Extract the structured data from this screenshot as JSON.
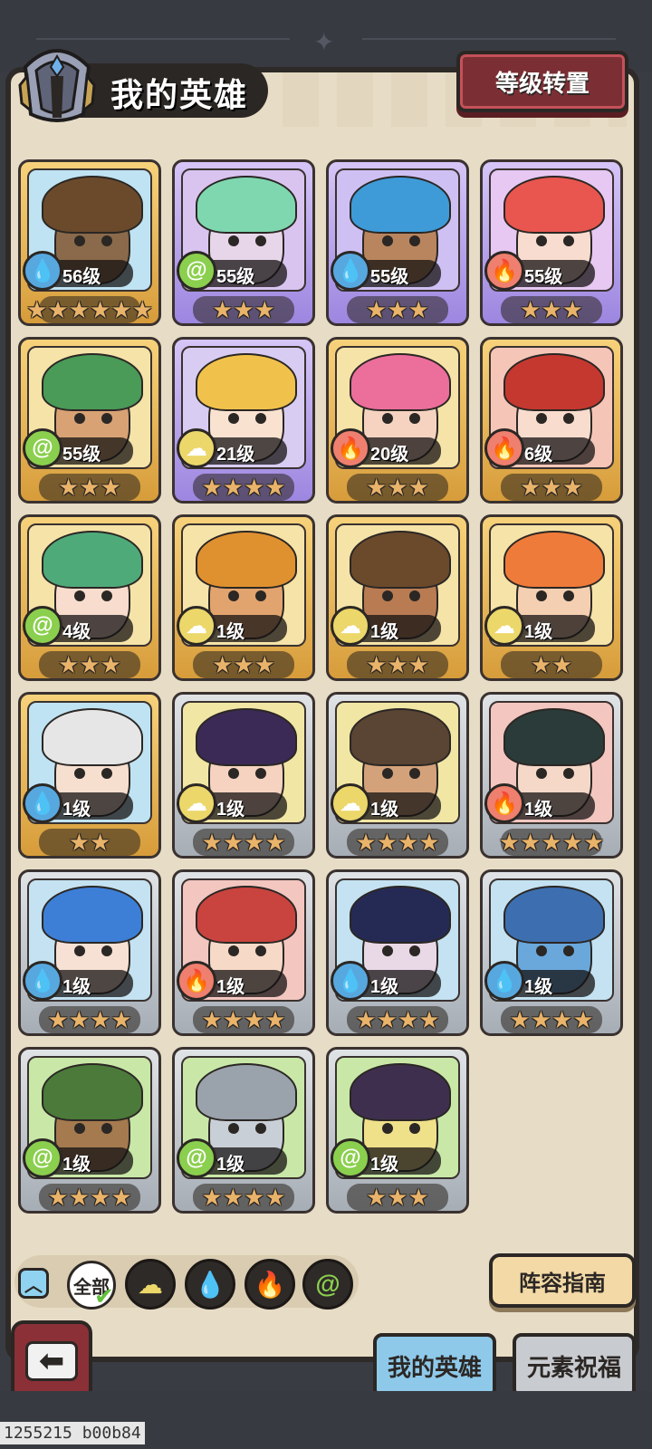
{
  "header": {
    "title": "我的英雄",
    "level_transfer_button": "等级转置"
  },
  "heroes": [
    {
      "level": "56级",
      "stars": 6,
      "element": "water",
      "frame": "gold",
      "bg": "#bfe3f2",
      "skin": "#8a6a4a",
      "hair": "#6b4a2c"
    },
    {
      "level": "55级",
      "stars": 3,
      "element": "wind",
      "frame": "purple",
      "bg": "#d9c4f0",
      "skin": "#e7d6ea",
      "hair": "#7fd7b0"
    },
    {
      "level": "55级",
      "stars": 3,
      "element": "water",
      "frame": "purple",
      "bg": "#cfc0f3",
      "skin": "#b9855e",
      "hair": "#3e9bd8"
    },
    {
      "level": "55级",
      "stars": 3,
      "element": "fire",
      "frame": "purple",
      "bg": "#e6c8f3",
      "skin": "#f8dcd0",
      "hair": "#e8564f"
    },
    {
      "level": "55级",
      "stars": 3,
      "element": "wind",
      "frame": "gold",
      "bg": "#f6e3a8",
      "skin": "#d8a275",
      "hair": "#4a9a58"
    },
    {
      "level": "21级",
      "stars": 4,
      "element": "earth",
      "frame": "purple",
      "bg": "#d8ccf2",
      "skin": "#fae2d1",
      "hair": "#f1c24b"
    },
    {
      "level": "20级",
      "stars": 3,
      "element": "fire",
      "frame": "gold",
      "bg": "#f6e3a8",
      "skin": "#f5d3c0",
      "hair": "#ec6e9b"
    },
    {
      "level": "6级",
      "stars": 3,
      "element": "fire",
      "frame": "gold",
      "bg": "#f5c6b8",
      "skin": "#f8dccd",
      "hair": "#c5382f"
    },
    {
      "level": "4级",
      "stars": 3,
      "element": "wind",
      "frame": "gold",
      "bg": "#f6e3a8",
      "skin": "#f8dccd",
      "hair": "#4faa7a"
    },
    {
      "level": "1级",
      "stars": 3,
      "element": "earth",
      "frame": "gold",
      "bg": "#f6e3a8",
      "skin": "#e2a46e",
      "hair": "#e0912f"
    },
    {
      "level": "1级",
      "stars": 3,
      "element": "earth",
      "frame": "gold",
      "bg": "#f6e3a8",
      "skin": "#b97b52",
      "hair": "#6b4a2c"
    },
    {
      "level": "1级",
      "stars": 2,
      "element": "earth",
      "frame": "gold",
      "bg": "#f6e3a8",
      "skin": "#f5cfb2",
      "hair": "#ef7b3a"
    },
    {
      "level": "1级",
      "stars": 2,
      "element": "water",
      "frame": "gold",
      "bg": "#bfe3f2",
      "skin": "#f7dfd0",
      "hair": "#e6e6e6"
    },
    {
      "level": "1级",
      "stars": 4,
      "element": "earth",
      "frame": "silver",
      "bg": "#f1e6a4",
      "skin": "#f5d3c0",
      "hair": "#3b2a55"
    },
    {
      "level": "1级",
      "stars": 4,
      "element": "earth",
      "frame": "silver",
      "bg": "#f1e6a4",
      "skin": "#d4a27a",
      "hair": "#5a4433"
    },
    {
      "level": "1级",
      "stars": 5,
      "element": "fire",
      "frame": "silver",
      "bg": "#f3c6c0",
      "skin": "#f5d8c8",
      "hair": "#2b3b3a"
    },
    {
      "level": "1级",
      "stars": 4,
      "element": "water",
      "frame": "silver",
      "bg": "#c4e2f1",
      "skin": "#f7e1d4",
      "hair": "#3d7fd6"
    },
    {
      "level": "1级",
      "stars": 4,
      "element": "fire",
      "frame": "silver",
      "bg": "#f3c6c0",
      "skin": "#f7d9c8",
      "hair": "#c9443e"
    },
    {
      "level": "1级",
      "stars": 4,
      "element": "water",
      "frame": "silver",
      "bg": "#c4e2f1",
      "skin": "#e9d8e6",
      "hair": "#252a55"
    },
    {
      "level": "1级",
      "stars": 4,
      "element": "water",
      "frame": "silver",
      "bg": "#c4e2f1",
      "skin": "#6aa8dc",
      "hair": "#3d6fb0"
    },
    {
      "level": "1级",
      "stars": 4,
      "element": "wind",
      "frame": "silver",
      "bg": "#c9e8a8",
      "skin": "#a57a4f",
      "hair": "#4b7a3a"
    },
    {
      "level": "1级",
      "stars": 4,
      "element": "wind",
      "frame": "silver",
      "bg": "#c9e8a8",
      "skin": "#c9cfd6",
      "hair": "#9aa2ab"
    },
    {
      "level": "1级",
      "stars": 3,
      "element": "wind",
      "frame": "silver",
      "bg": "#c9e8a8",
      "skin": "#efe08a",
      "hair": "#3f2f4f"
    }
  ],
  "filters": {
    "all_label": "全部",
    "elements": [
      "earth",
      "water",
      "fire",
      "wind"
    ]
  },
  "guide_button": "阵容指南",
  "tabs": {
    "my_heroes": "我的英雄",
    "element_blessing": "元素祝福"
  },
  "build_id": "1255215 b00b84",
  "colors": {
    "water": "#58a8e0",
    "wind": "#8bcf4e",
    "fire": "#ef7f6e",
    "earth": "#ecd76a"
  }
}
